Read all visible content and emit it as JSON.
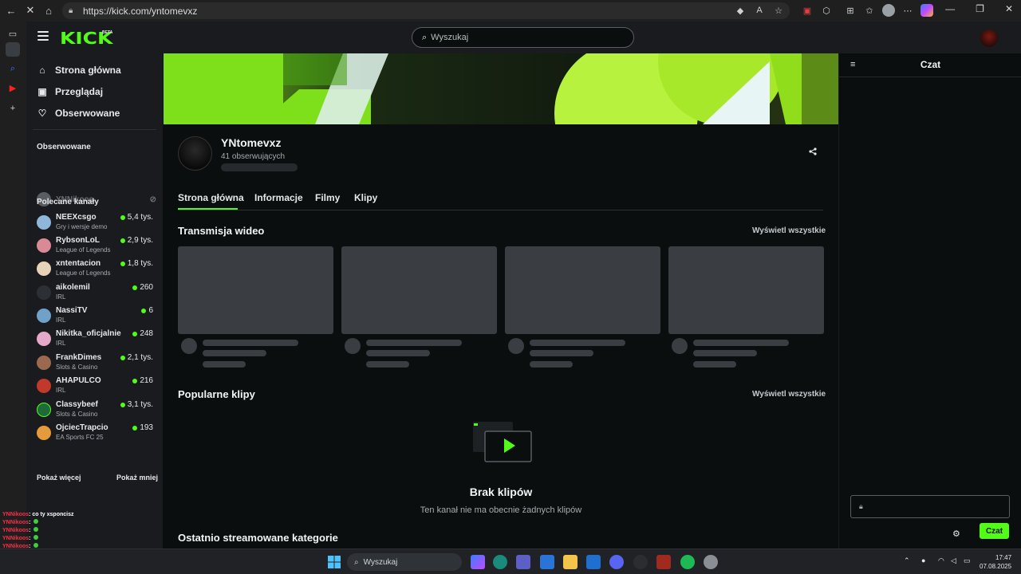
{
  "browser": {
    "url": "https://kick.com/yntomevxz"
  },
  "topbar": {
    "search_placeholder": "Wyszukaj"
  },
  "sidebar": {
    "nav": [
      {
        "label": "Strona główna"
      },
      {
        "label": "Przeglądaj"
      },
      {
        "label": "Obserwowane"
      }
    ],
    "followed_heading": "Obserwowane",
    "followed": [
      {
        "name": "YNNikoos"
      }
    ],
    "recommended_heading": "Polecane kanały",
    "channels": [
      {
        "name": "NEEXcsgo",
        "category": "Gry i wersje demo",
        "viewers": "5,4 tys."
      },
      {
        "name": "RybsonLoL",
        "category": "League of Legends",
        "viewers": "2,9 tys."
      },
      {
        "name": "xntentacion",
        "category": "League of Legends",
        "viewers": "1,8 tys."
      },
      {
        "name": "aikolemil",
        "category": "IRL",
        "viewers": "260"
      },
      {
        "name": "NassiTV",
        "category": "IRL",
        "viewers": "6"
      },
      {
        "name": "Nikitka_oficjalnie",
        "category": "IRL",
        "viewers": "248"
      },
      {
        "name": "FrankDimes",
        "category": "Slots & Casino",
        "viewers": "2,1 tys."
      },
      {
        "name": "AHAPULCO",
        "category": "IRL",
        "viewers": "216"
      },
      {
        "name": "Classybeef",
        "category": "Slots & Casino",
        "viewers": "3,1 tys."
      },
      {
        "name": "OjciecTrapcio",
        "category": "EA Sports FC 25",
        "viewers": "193"
      }
    ],
    "show_more": "Pokaż więcej",
    "show_less": "Pokaż mniej"
  },
  "channel": {
    "name": "YNtomevxz",
    "followers": "41 obserwujących",
    "tabs": [
      "Strona główna",
      "Informacje",
      "Filmy",
      "Klipy"
    ]
  },
  "sections": {
    "videos_title": "Transmisja wideo",
    "videos_view_all": "Wyświetl wszystkie",
    "clips_title": "Popularne klipy",
    "clips_view_all": "Wyświetl wszystkie",
    "clips_empty_title": "Brak klipów",
    "clips_empty_desc": "Ten kanał nie ma obecnie żadnych klipów",
    "recent_categories_title": "Ostatnio streamowane kategorie"
  },
  "chat": {
    "title": "Czat",
    "send_label": "Czat"
  },
  "overlay_chat": [
    {
      "user": "YNNikoos",
      "msg": "co ty xsponcisz"
    },
    {
      "user": "YNNikoos",
      "msg": ""
    },
    {
      "user": "YNNikoos",
      "msg": ""
    },
    {
      "user": "YNNikoos",
      "msg": ""
    },
    {
      "user": "YNNikoos",
      "msg": ""
    }
  ],
  "taskbar": {
    "search_placeholder": "Wyszukaj",
    "time": "17:47",
    "date": "07.08.2025"
  },
  "colors": {
    "accent": "#53fc18",
    "background": "#0b0e0f",
    "panel": "#191b1f",
    "skeleton": "#3a3d41"
  }
}
